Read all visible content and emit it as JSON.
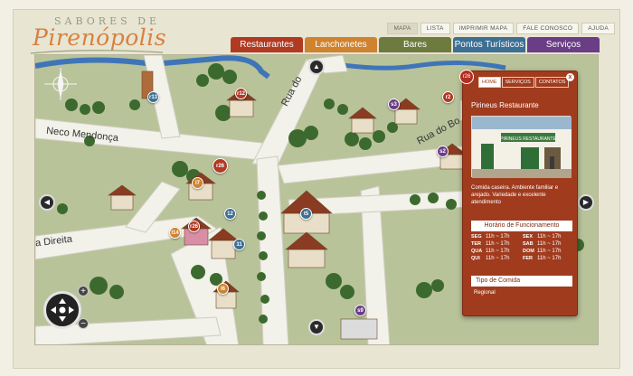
{
  "logo": {
    "top": "SABORES DE",
    "main": "Pirenópolis"
  },
  "top_tabs": [
    {
      "label": "Mapa",
      "active": true
    },
    {
      "label": "Lista",
      "active": false
    },
    {
      "label": "Imprimir Mapa",
      "active": false
    },
    {
      "label": "Fale Conosco",
      "active": false
    },
    {
      "label": "Ajuda",
      "active": false
    }
  ],
  "categories": [
    {
      "label": "Restaurantes",
      "color": "#b03a22"
    },
    {
      "label": "Lanchonetes",
      "color": "#d0832e"
    },
    {
      "label": "Bares",
      "color": "#6d7b3f"
    },
    {
      "label": "Pontos Turísticos",
      "color": "#3d6f93"
    },
    {
      "label": "Serviços",
      "color": "#6b3d86"
    }
  ],
  "streets": {
    "neco": "Neco Mendonça",
    "direita": "a Direita",
    "ruado": "Rua do",
    "ruabo": "Rua do Bo"
  },
  "pins": [
    {
      "label": "r13",
      "color": "#3d6f93"
    },
    {
      "label": "r12",
      "color": "#b03a22"
    },
    {
      "label": "s3",
      "color": "#6b3d86"
    },
    {
      "label": "r26",
      "color": "#b03a22"
    },
    {
      "label": "l7",
      "color": "#d0832e"
    },
    {
      "label": "r26",
      "color": "#b03a22"
    },
    {
      "label": "l14",
      "color": "#d0832e"
    },
    {
      "label": "12",
      "color": "#3d6f93"
    },
    {
      "label": "11",
      "color": "#3d6f93"
    },
    {
      "label": "t5",
      "color": "#3d6f93"
    },
    {
      "label": "s2",
      "color": "#6b3d86"
    },
    {
      "label": "l6",
      "color": "#d0832e"
    },
    {
      "label": "s9",
      "color": "#6b3d86"
    },
    {
      "label": "r2",
      "color": "#b03a22"
    }
  ],
  "popup": {
    "number": "r26",
    "tabs": [
      {
        "label": "HOME",
        "active": true
      },
      {
        "label": "SERVIÇOS",
        "active": false
      },
      {
        "label": "CONTATOS",
        "active": false
      }
    ],
    "close": "x",
    "title": "Pirineus Restaurante",
    "sign_text": "PIRINEUS RESTAURANTE",
    "description": "Comida caseira. Ambiente familiar e arejado. Variedade e excelente atendimento",
    "hours_title": "Horário de Funcionamento",
    "hours": [
      {
        "d1": "SEG",
        "t1": "11h ~ 17h",
        "d2": "SEX",
        "t2": "11h ~ 17h"
      },
      {
        "d1": "TER",
        "t1": "11h ~ 17h",
        "d2": "SAB",
        "t2": "11h ~ 17h"
      },
      {
        "d1": "QUA",
        "t1": "11h ~ 17h",
        "d2": "DOM",
        "t2": "11h ~ 17h"
      },
      {
        "d1": "QUI",
        "t1": "11h ~ 17h",
        "d2": "FER",
        "t2": "11h ~ 17h"
      }
    ],
    "food_type_title": "Tipo de Comida",
    "food_type": "Regional"
  },
  "controls": {
    "zoom_in": "+",
    "zoom_out": "−",
    "left": "◀",
    "right": "▶",
    "up": "▲",
    "down": "▼"
  }
}
